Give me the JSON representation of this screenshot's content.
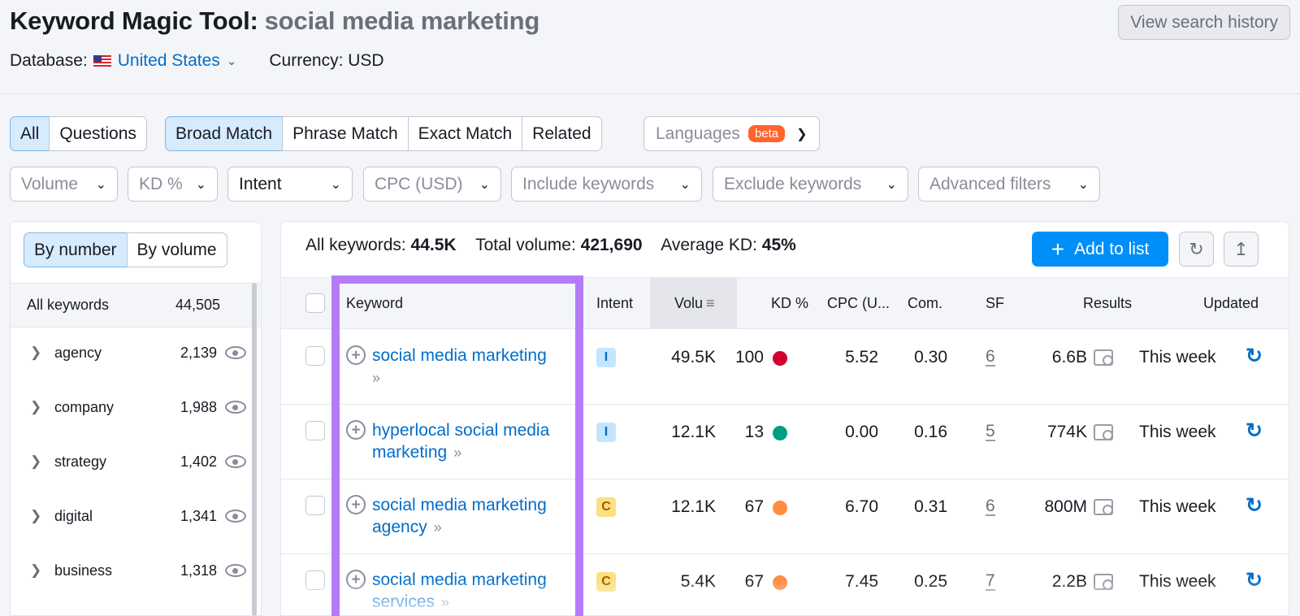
{
  "header": {
    "tool_title": "Keyword Magic Tool:",
    "keyword": "social media marketing",
    "history_button": "View search history",
    "database_label": "Database:",
    "database_value": "United States",
    "currency_label": "Currency: USD"
  },
  "tabs": {
    "scope": [
      "All",
      "Questions"
    ],
    "scope_active": "All",
    "match": [
      "Broad Match",
      "Phrase Match",
      "Exact Match",
      "Related"
    ],
    "match_active": "Broad Match",
    "languages_label": "Languages",
    "languages_badge": "beta"
  },
  "filters": [
    "Volume",
    "KD %",
    "Intent",
    "CPC (USD)",
    "Include keywords",
    "Exclude keywords",
    "Advanced filters"
  ],
  "sidebar": {
    "toggle": [
      "By number",
      "By volume"
    ],
    "toggle_active": "By number",
    "all_label": "All keywords",
    "all_count": "44,505",
    "groups": [
      {
        "name": "agency",
        "count": "2,139"
      },
      {
        "name": "company",
        "count": "1,988"
      },
      {
        "name": "strategy",
        "count": "1,402"
      },
      {
        "name": "digital",
        "count": "1,341"
      },
      {
        "name": "business",
        "count": "1,318"
      }
    ]
  },
  "summary": {
    "all_label": "All keywords:",
    "all_value": "44.5K",
    "volume_label": "Total volume:",
    "volume_value": "421,690",
    "kd_label": "Average KD:",
    "kd_value": "45%",
    "add_button": "Add to list"
  },
  "table": {
    "columns": [
      "Keyword",
      "Intent",
      "Volu",
      "KD %",
      "CPC (U...",
      "Com.",
      "SF",
      "Results",
      "Updated"
    ],
    "rows": [
      {
        "keyword": "social media marketing",
        "intent": "I",
        "volume": "49.5K",
        "kd": "100",
        "kd_color": "#d1002f",
        "cpc": "5.52",
        "com": "0.30",
        "sf": "6",
        "results": "6.6B",
        "updated": "This week"
      },
      {
        "keyword": "hyperlocal social media marketing",
        "intent": "I",
        "volume": "12.1K",
        "kd": "13",
        "kd_color": "#009f81",
        "cpc": "0.00",
        "com": "0.16",
        "sf": "5",
        "results": "774K",
        "updated": "This week"
      },
      {
        "keyword": "social media marketing agency",
        "intent": "C",
        "volume": "12.1K",
        "kd": "67",
        "kd_color": "#ff8c43",
        "cpc": "6.70",
        "com": "0.31",
        "sf": "6",
        "results": "800M",
        "updated": "This week"
      },
      {
        "keyword": "social media marketing services",
        "intent": "C",
        "volume": "5.4K",
        "kd": "67",
        "kd_color": "#ff8c43",
        "cpc": "7.45",
        "com": "0.25",
        "sf": "7",
        "results": "2.2B",
        "updated": "This week"
      }
    ]
  },
  "colors": {
    "accent": "#008ff8",
    "link": "#006dca",
    "highlight": "#b57bf7"
  }
}
